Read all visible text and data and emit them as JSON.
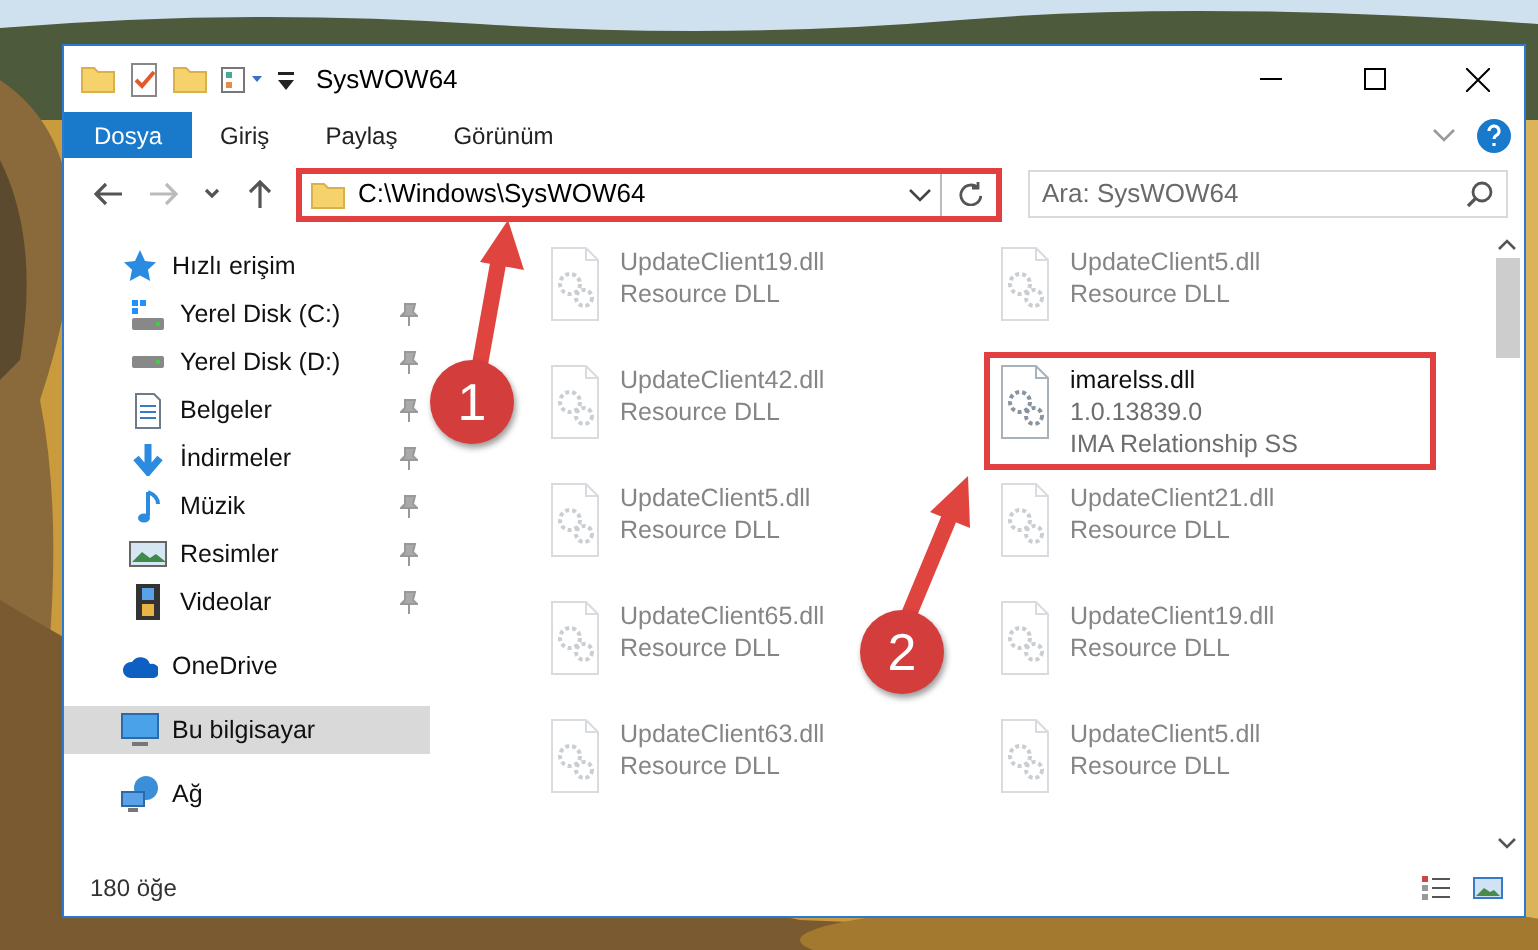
{
  "window": {
    "title": "SysWOW64"
  },
  "ribbon_tabs": [
    {
      "label": "Dosya",
      "selected": true
    },
    {
      "label": "Giriş",
      "selected": false
    },
    {
      "label": "Paylaş",
      "selected": false
    },
    {
      "label": "Görünüm",
      "selected": false
    }
  ],
  "address": {
    "path": "C:\\Windows\\SysWOW64",
    "highlighted": true
  },
  "search": {
    "placeholder": "Ara: SysWOW64"
  },
  "sidebar": {
    "items": [
      {
        "label": "Hızlı erişim",
        "kind": "quick",
        "selected": false,
        "children": [
          {
            "label": "Yerel Disk (C:)",
            "kind": "drive-c",
            "pinned": true
          },
          {
            "label": "Yerel Disk (D:)",
            "kind": "drive",
            "pinned": true
          },
          {
            "label": "Belgeler",
            "kind": "docs",
            "pinned": true
          },
          {
            "label": "İndirmeler",
            "kind": "download",
            "pinned": true
          },
          {
            "label": "Müzik",
            "kind": "music",
            "pinned": true
          },
          {
            "label": "Resimler",
            "kind": "pictures",
            "pinned": true
          },
          {
            "label": "Videolar",
            "kind": "videos",
            "pinned": true
          }
        ]
      },
      {
        "label": "OneDrive",
        "kind": "cloud",
        "selected": false
      },
      {
        "label": "Bu bilgisayar",
        "kind": "computer",
        "selected": true
      },
      {
        "label": "Ağ",
        "kind": "network",
        "selected": false
      }
    ]
  },
  "files": [
    {
      "name": "UpdateClient19.dll",
      "lines": [
        "Resource DLL"
      ],
      "blurred": true,
      "highlighted": false
    },
    {
      "name": "UpdateClient5.dll",
      "lines": [
        "Resource DLL"
      ],
      "blurred": true,
      "highlighted": false
    },
    {
      "name": "UpdateClient42.dll",
      "lines": [
        "Resource DLL"
      ],
      "blurred": true,
      "highlighted": false
    },
    {
      "name": "imarelss.dll",
      "lines": [
        "1.0.13839.0",
        "IMA Relationship SS"
      ],
      "blurred": false,
      "highlighted": true
    },
    {
      "name": "UpdateClient5.dll",
      "lines": [
        "Resource DLL"
      ],
      "blurred": true,
      "highlighted": false
    },
    {
      "name": "UpdateClient21.dll",
      "lines": [
        "Resource DLL"
      ],
      "blurred": true,
      "highlighted": false
    },
    {
      "name": "UpdateClient65.dll",
      "lines": [
        "Resource DLL"
      ],
      "blurred": true,
      "highlighted": false
    },
    {
      "name": "UpdateClient19.dll",
      "lines": [
        "Resource DLL"
      ],
      "blurred": true,
      "highlighted": false
    },
    {
      "name": "UpdateClient63.dll",
      "lines": [
        "Resource DLL"
      ],
      "blurred": true,
      "highlighted": false
    },
    {
      "name": "UpdateClient5.dll",
      "lines": [
        "Resource DLL"
      ],
      "blurred": true,
      "highlighted": false
    }
  ],
  "status_bar": {
    "count": "180 öğe"
  },
  "annotations": [
    {
      "number": "1"
    },
    {
      "number": "2"
    }
  ]
}
